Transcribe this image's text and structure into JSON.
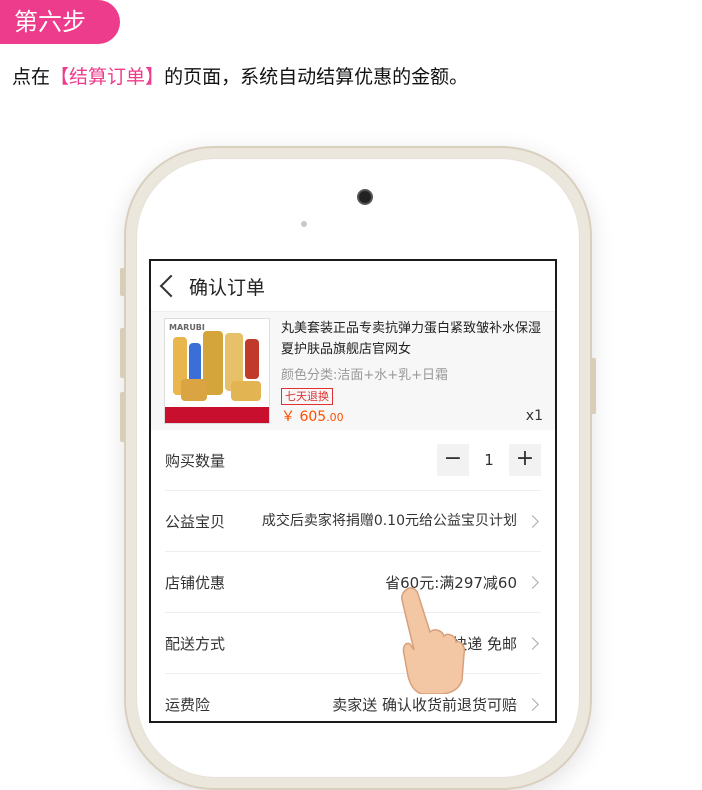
{
  "step": {
    "label": "第六步"
  },
  "instruction": {
    "prefix": "点在",
    "bracket_open": "【",
    "highlight": "结算订单",
    "bracket_close": "】",
    "suffix": "的页面，系统自动结算优惠的金额。",
    "highlight_color": "#ee3c8c"
  },
  "screen": {
    "nav": {
      "title": "确认订单"
    },
    "product": {
      "title": "丸美套装正品专卖抗弹力蛋白紧致皱补水保湿夏护肤品旗舰店官网女",
      "spec": "颜色分类:洁面+水+乳+日霜",
      "tag": "七天退换",
      "price_symbol": "￥",
      "price_main": "605",
      "price_decimal": ".00",
      "quantity": "x1",
      "thumb_brand": "MARUBI"
    },
    "rows": {
      "quantity": {
        "label": "购买数量",
        "minus": "−",
        "value": "1",
        "plus": "+"
      },
      "charity": {
        "label": "公益宝贝",
        "value": "成交后卖家将捐赠0.10元给公益宝贝计划"
      },
      "discount": {
        "label": "店铺优惠",
        "value": "省60元:满297减60"
      },
      "shipping": {
        "label": "配送方式",
        "value": "快递 免邮"
      },
      "insurance": {
        "label": "运费险",
        "value": "卖家送 确认收货前退货可赔"
      }
    }
  },
  "colors": {
    "accent": "#ee3c8c",
    "price": "#ff5000",
    "tag": "#e03030"
  }
}
